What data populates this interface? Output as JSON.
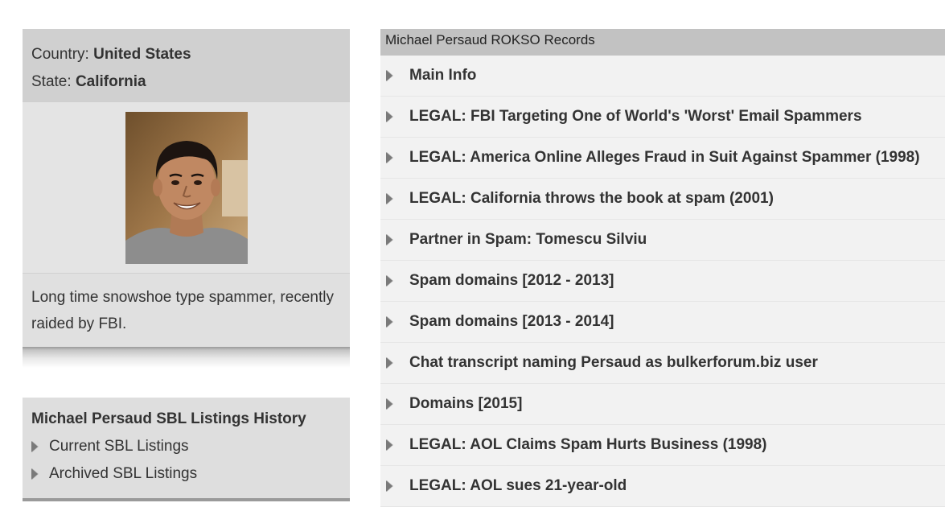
{
  "location": {
    "country_label": "Country:",
    "country_value": "United States",
    "state_label": "State:",
    "state_value": "California"
  },
  "photo": {
    "icon": "person-photo"
  },
  "description": "Long time snowshoe type spammer, recently raided by FBI.",
  "sbl": {
    "title": "Michael Persaud SBL Listings History",
    "items": [
      "Current SBL Listings",
      "Archived SBL Listings"
    ]
  },
  "rokso": {
    "header": "Michael Persaud ROKSO Records",
    "items": [
      "Main Info",
      "LEGAL: FBI Targeting One of World's 'Worst' Email Spammers",
      "LEGAL: America Online Alleges Fraud in Suit Against Spammer (1998)",
      "LEGAL: California throws the book at spam (2001)",
      "Partner in Spam: Tomescu Silviu",
      "Spam domains [2012 - 2013]",
      "Spam domains [2013 - 2014]",
      "Chat transcript naming Persaud as bulkerforum.biz user",
      "Domains [2015]",
      "LEGAL: AOL Claims Spam Hurts Business (1998)",
      "LEGAL: AOL sues 21-year-old"
    ]
  },
  "colors": {
    "header_bg": "#c2c2c2",
    "panel_bg": "#d0d0d0",
    "list_bg": "#f2f2f2",
    "text": "#333333"
  }
}
